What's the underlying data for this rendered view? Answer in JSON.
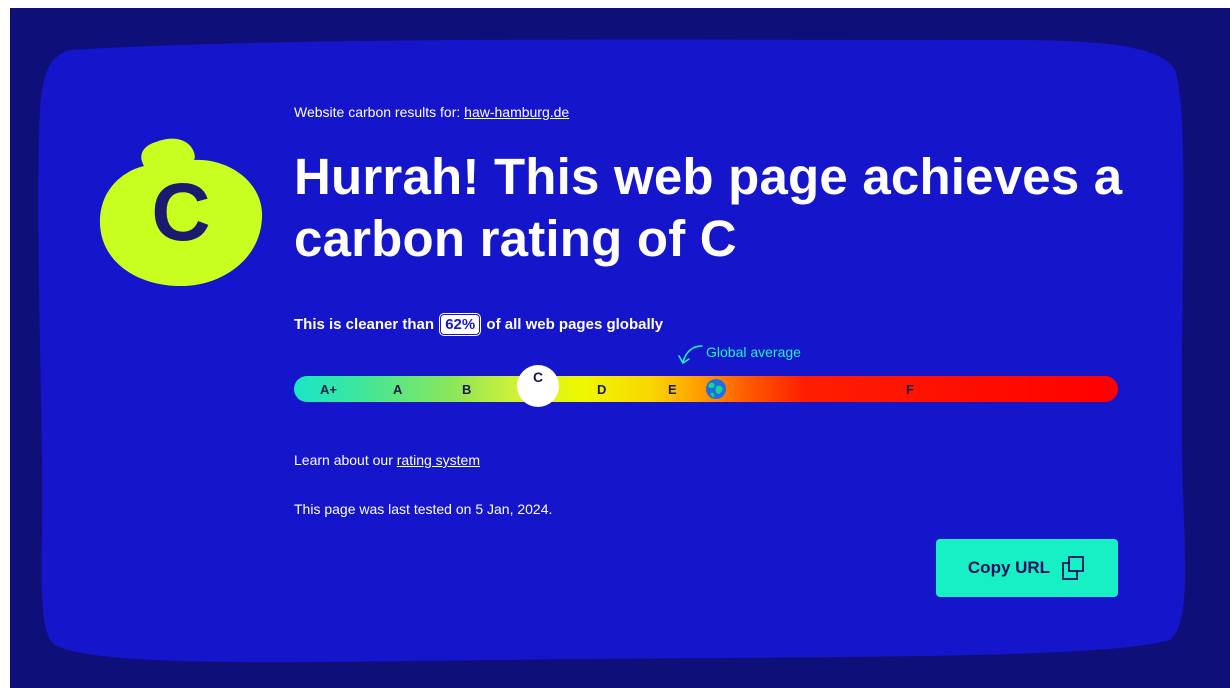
{
  "header": {
    "results_prefix": "Website carbon results for:",
    "site": "haw-hamburg.de"
  },
  "grade": {
    "letter": "C",
    "badge_color": "#c8ff1e"
  },
  "headline": "Hurrah! This web page achieves a carbon rating of C",
  "comparison": {
    "prefix": "This is cleaner than",
    "percent": "62%",
    "suffix": "of all web pages globally"
  },
  "scale": {
    "global_average_label": "Global average",
    "grades": [
      "A+",
      "A",
      "B",
      "C",
      "D",
      "E",
      "F"
    ],
    "current_grade": "C"
  },
  "learn": {
    "prefix": "Learn about our",
    "link": "rating system"
  },
  "tested_text": "This page was last tested on 5 Jan, 2024.",
  "copy_button": {
    "label": "Copy URL",
    "icon": "copy-icon",
    "color": "#17efc4"
  },
  "colors": {
    "panel": "#1515cc",
    "background": "#0f0f7a",
    "accent": "#1ef2c8"
  }
}
